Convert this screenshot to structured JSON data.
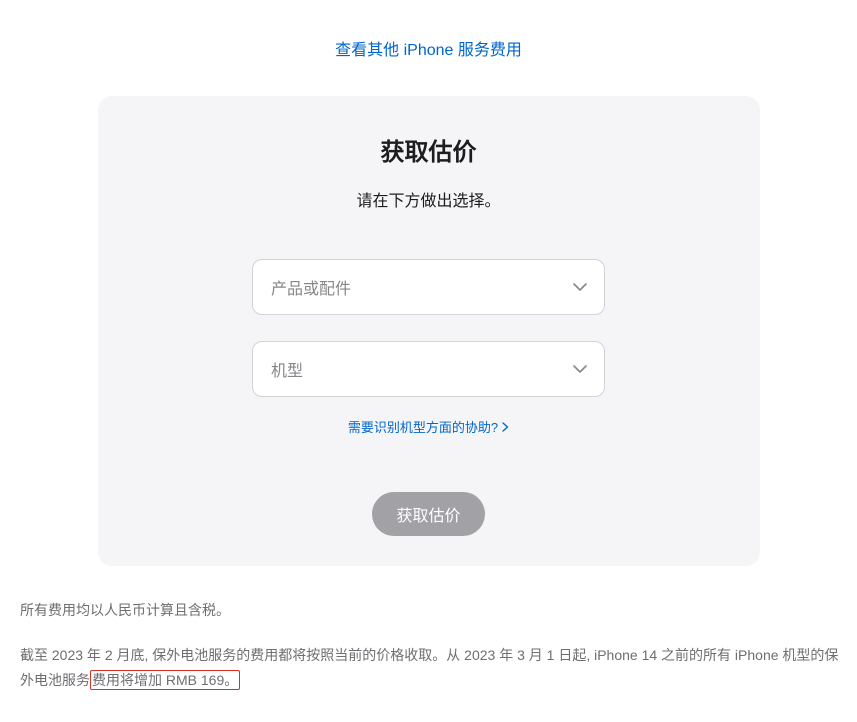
{
  "topLink": "查看其他 iPhone 服务费用",
  "card": {
    "title": "获取估价",
    "subtitle": "请在下方做出选择。",
    "select1": {
      "placeholder": "产品或配件"
    },
    "select2": {
      "placeholder": "机型"
    },
    "helpLink": "需要识别机型方面的协助?",
    "submitButton": "获取估价"
  },
  "footer": {
    "line1": "所有费用均以人民币计算且含税。",
    "line2_pre": "截至 2023 年 2 月底, 保外电池服务的费用都将按照当前的价格收取。从 2023 年 3 月 1 日起, iPhone 14 之前的所有 iPhone 机型的保外电池服务",
    "line2_highlight": "费用将增加 RMB 169。"
  }
}
